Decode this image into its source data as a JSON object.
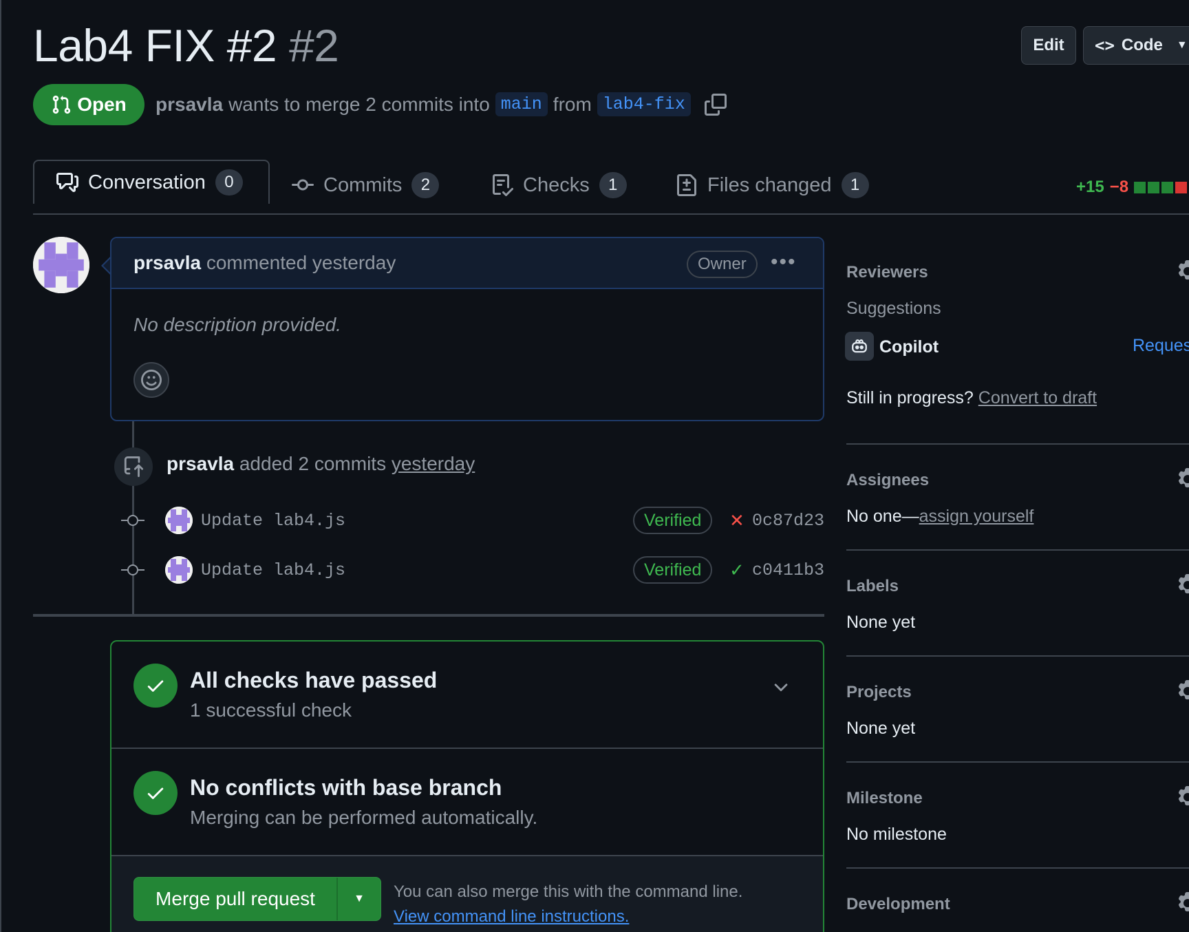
{
  "header": {
    "title": "Lab4 FIX #2",
    "number": "#2",
    "edit_label": "Edit",
    "code_label": "Code"
  },
  "state": {
    "label": "Open",
    "author": "prsavla",
    "merge_text": "wants to merge 2 commits into",
    "base_branch": "main",
    "from_text": "from",
    "head_branch": "lab4-fix"
  },
  "tabs": [
    {
      "label": "Conversation",
      "count": "0"
    },
    {
      "label": "Commits",
      "count": "2"
    },
    {
      "label": "Checks",
      "count": "1"
    },
    {
      "label": "Files changed",
      "count": "1"
    }
  ],
  "diffstat": {
    "additions": "+15",
    "deletions": "−8"
  },
  "comment": {
    "author": "prsavla",
    "action": "commented yesterday",
    "badge": "Owner",
    "body": "No description provided."
  },
  "push_event": {
    "author": "prsavla",
    "text": "added 2 commits",
    "when": "yesterday"
  },
  "commits": [
    {
      "message": "Update lab4.js",
      "badge": "Verified",
      "status": "fail",
      "sha": "0c87d23"
    },
    {
      "message": "Update lab4.js",
      "badge": "Verified",
      "status": "pass",
      "sha": "c0411b3"
    }
  ],
  "merge_box": {
    "checks_title": "All checks have passed",
    "checks_sub": "1 successful check",
    "conflicts_title": "No conflicts with base branch",
    "conflicts_sub": "Merging can be performed automatically.",
    "merge_button": "Merge pull request",
    "cli_note": "You can also merge this with the command line.",
    "cli_link": "View command line instructions."
  },
  "sidebar": {
    "reviewers": {
      "heading": "Reviewers",
      "suggestions": "Suggestions",
      "suggested_user": "Copilot",
      "request_label": "Reques",
      "draft_prompt": "Still in progress?",
      "draft_link": "Convert to draft"
    },
    "assignees": {
      "heading": "Assignees",
      "value": "No one—",
      "link": "assign yourself"
    },
    "labels": {
      "heading": "Labels",
      "value": "None yet"
    },
    "projects": {
      "heading": "Projects",
      "value": "None yet"
    },
    "milestone": {
      "heading": "Milestone",
      "value": "No milestone"
    },
    "development": {
      "heading": "Development"
    }
  },
  "colors": {
    "background": "#0d1117",
    "success": "#238636",
    "accent": "#4493f8",
    "danger": "#f85149"
  }
}
